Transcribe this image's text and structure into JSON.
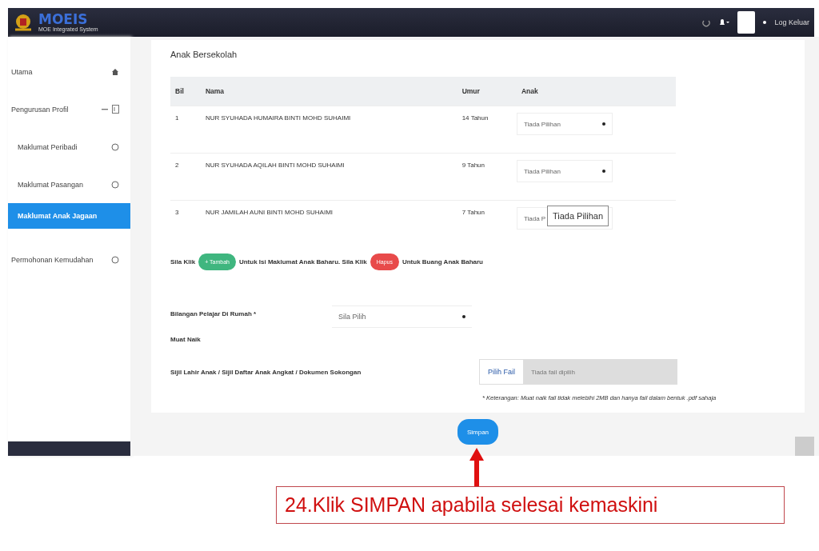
{
  "header": {
    "logo_text": "MOEIS",
    "logo_subtitle": "MOE Integrated System",
    "logout": "Log Keluar"
  },
  "sidebar": {
    "items": [
      {
        "label": "Utama",
        "selected": false
      },
      {
        "label": "Pengurusan Profil",
        "selected": false,
        "expanded": true,
        "children": [
          {
            "label": "Maklumat Peribadi",
            "selected": false
          },
          {
            "label": "Maklumat Pasangan",
            "selected": false
          },
          {
            "label": "Maklumat Anak Jagaan",
            "selected": true
          }
        ]
      },
      {
        "label": "Permohonan Kemudahan",
        "selected": false
      }
    ]
  },
  "card": {
    "title": "Anak Bersekolah",
    "table": {
      "columns": [
        "Bil",
        "Nama",
        "Umur",
        "Anak"
      ],
      "rows": [
        {
          "no": "1",
          "name": "NUR SYUHADA HUMAIRA BINTI MOHD SUHAIMI",
          "age": "14 Tahun",
          "choice": "Tiada Pilihan"
        },
        {
          "no": "2",
          "name": "NUR SYUHADA AQILAH BINTI MOHD SUHAIMI",
          "age": "9 Tahun",
          "choice": "Tiada Pilihan"
        },
        {
          "no": "3",
          "name": "NUR JAMILAH AUNI BINTI MOHD SUHAIMI",
          "age": "7 Tahun",
          "choice": "Tiada P",
          "dropdown_option": "Tiada Pilihan"
        }
      ]
    },
    "instruction": {
      "part1": "Sila Klik",
      "add_button": "+ Tambah",
      "part2": "Untuk Isi Maklumat Anak Baharu. Sila Klik",
      "delete_button": "Hapus",
      "part3": "Untuk Buang Anak Baharu"
    },
    "student_count": {
      "label": "Bilangan Pelajar Di Rumah *",
      "value": "Sila Pilih"
    },
    "upload_heading": "Muat Naik",
    "upload": {
      "label": "Sijil Lahir Anak / Sijil Daftar Anak Angkat / Dokumen Sokongan",
      "button": "Pilih Fail",
      "file_status": "Tiada fail dipilih",
      "note": "* Keterangan: Muat naik fail tidak melebihi 2MB dan hanya fail dalam bentuk .pdf sahaja"
    }
  },
  "save_button": "Simpan",
  "annotation": "24.Klik SIMPAN apabila selesai kemaskini"
}
